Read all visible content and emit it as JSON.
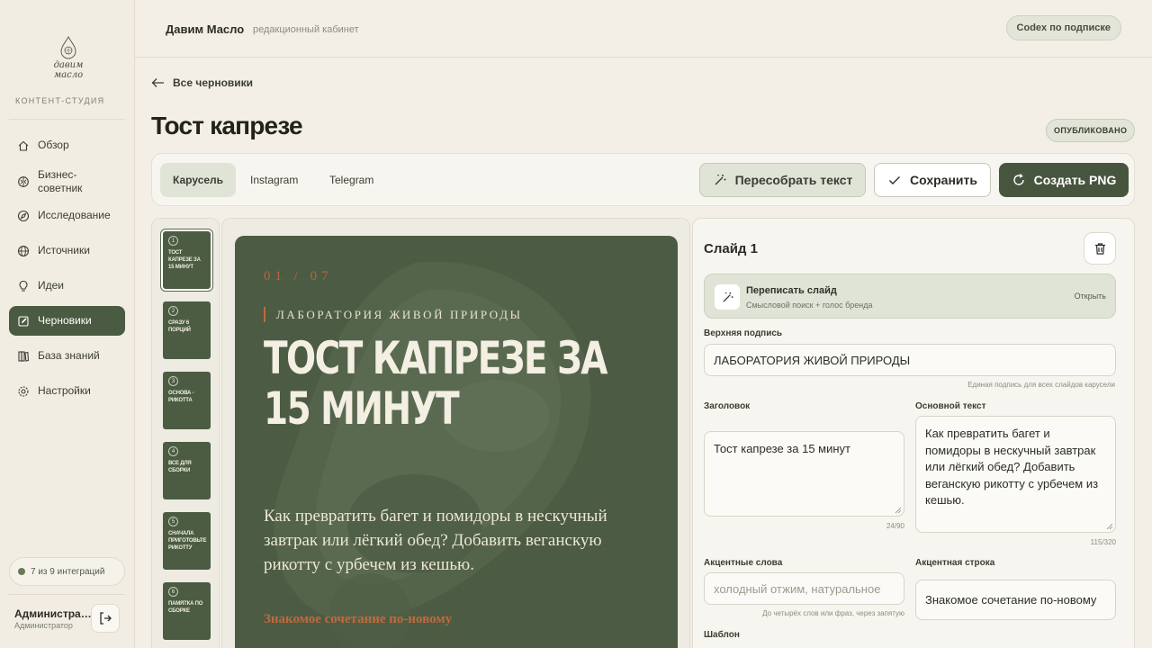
{
  "sidebar": {
    "logo_text": "давим масло",
    "section_label": "КОНТЕНТ-СТУДИЯ",
    "items": [
      {
        "label": "Обзор",
        "icon": "home-icon"
      },
      {
        "label": "Бизнес-\nсоветник",
        "icon": "brain-icon"
      },
      {
        "label": "Исследование",
        "icon": "compass-icon"
      },
      {
        "label": "Источники",
        "icon": "globe-icon"
      },
      {
        "label": "Идеи",
        "icon": "lightbulb-icon"
      },
      {
        "label": "Черновики",
        "icon": "edit-icon",
        "active": true
      },
      {
        "label": "База знаний",
        "icon": "library-icon"
      },
      {
        "label": "Настройки",
        "icon": "gear-icon"
      }
    ],
    "integrations": "7 из 9 интеграций",
    "user_name": "Администра…",
    "user_role": "Администратор"
  },
  "header": {
    "brand": "Давим Масло",
    "subtitle": "редакционный кабинет",
    "plan": "Codex по подписке"
  },
  "page": {
    "back": "Все черновики",
    "title": "Тост капрезе",
    "status": "ОПУБЛИКОВАНО"
  },
  "toolbar": {
    "tabs": [
      "Карусель",
      "Instagram",
      "Telegram"
    ],
    "rebuild": "Пересобрать текст",
    "save": "Сохранить",
    "png": "Создать PNG"
  },
  "thumbnails": [
    {
      "num": "1",
      "title": "ТОСТ КАПРЕЗЕ ЗА 15 МИНУТ"
    },
    {
      "num": "2",
      "title": "СРАЗУ 6 ПОРЦИЙ"
    },
    {
      "num": "3",
      "title": "ОСНОВА - РИКОТТА"
    },
    {
      "num": "4",
      "title": "ВСЕ ДЛЯ СБОРКИ"
    },
    {
      "num": "5",
      "title": "СНАЧАЛА ПРИГОТОВЬТЕ РИКОТТУ"
    },
    {
      "num": "6",
      "title": "ПАМЯТКА ПО СБОРКЕ"
    }
  ],
  "slide": {
    "counter": "01 / 07",
    "kicker": "ЛАБОРАТОРИЯ ЖИВОЙ ПРИРОДЫ",
    "title": "ТОСТ КАПРЕЗЕ ЗА 15 МИНУТ",
    "body": "Как превратить багет и помидоры в нескучный завтрак или лёгкий обед? Добавить веганскую рикотту с урбечем из кешью.",
    "accent": "Знакомое сочетание по-новому"
  },
  "editor": {
    "title": "Слайд 1",
    "rewrite_title": "Переписать слайд",
    "rewrite_sub": "Смысловой поиск + голос бренда",
    "rewrite_open": "Открыть",
    "caption_label": "Верхняя подпись",
    "caption_value": "ЛАБОРАТОРИЯ ЖИВОЙ ПРИРОДЫ",
    "caption_hint": "Единая подпись для всех слайдов карусели",
    "heading_label": "Заголовок",
    "heading_value": "Тост капрезе за 15 минут",
    "heading_count": "24/90",
    "body_label": "Основной текст",
    "body_value": "Как превратить багет и помидоры в нескучный завтрак или лёгкий обед? Добавить веганскую рикотту с урбечем из кешью.",
    "body_count": "115/320",
    "accent_words_label": "Акцентные слова",
    "accent_words_placeholder": "холодный отжим, натуральное",
    "accent_words_hint": "До четырёх слов или фраз, через запятую",
    "accent_line_label": "Акцентная строка",
    "accent_line_value": "Знакомое сочетание по-новому",
    "template_label": "Шаблон"
  },
  "colors": {
    "accent": "#4b5a42",
    "slide_bg": "#4c5b43",
    "accent_orange": "#c06a3c",
    "background": "#f3efe6"
  }
}
